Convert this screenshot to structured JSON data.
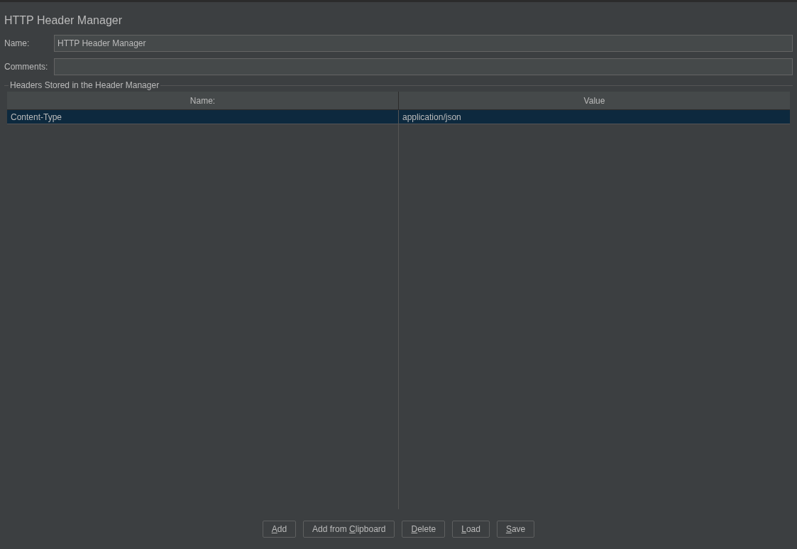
{
  "title": "HTTP Header Manager",
  "fields": [
    {
      "label": "Name:",
      "value": "HTTP Header Manager"
    },
    {
      "label": "Comments:"
    }
  ],
  "group": {
    "title": "Headers Stored in the Header Manager"
  },
  "table": {
    "columns": [
      "Name:",
      "Value"
    ],
    "rows": [
      {
        "cells": [
          "Content-Type",
          "application/json"
        ],
        "selected": true
      }
    ]
  },
  "buttons": [
    {
      "label_parts": [
        {
          "text": "A",
          "underlined": true
        },
        {
          "text": "dd",
          "underlined": false
        }
      ]
    },
    {
      "label_parts": [
        {
          "text": "Add from ",
          "underlined": false
        },
        {
          "text": "C",
          "underlined": true
        },
        {
          "text": "lipboard",
          "underlined": false
        }
      ]
    },
    {
      "label_parts": [
        {
          "text": "D",
          "underlined": true
        },
        {
          "text": "elete",
          "underlined": false
        }
      ]
    },
    {
      "label_parts": [
        {
          "text": "L",
          "underlined": true
        },
        {
          "text": "oad",
          "underlined": false
        }
      ]
    },
    {
      "label_parts": [
        {
          "text": "S",
          "underlined": true
        },
        {
          "text": "ave",
          "underlined": false
        }
      ]
    }
  ]
}
